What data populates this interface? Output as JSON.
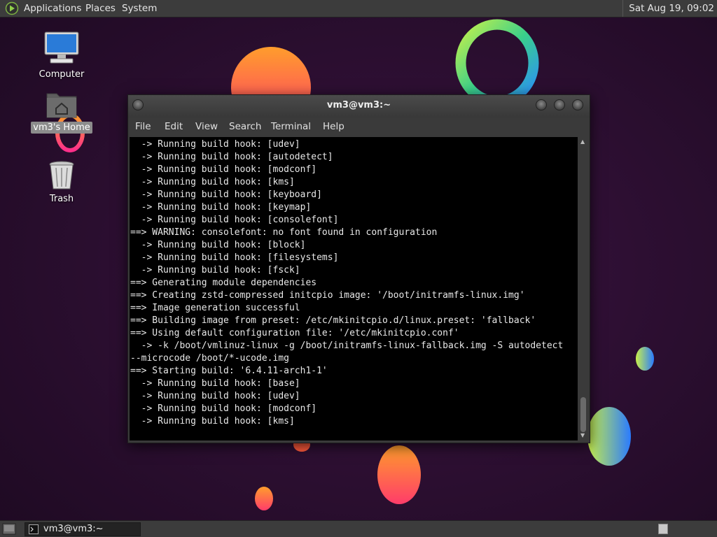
{
  "top_panel": {
    "menus": [
      "Applications",
      "Places",
      "System"
    ],
    "clock": "Sat Aug 19, 09:02"
  },
  "desktop_icons": [
    {
      "label": "Computer",
      "icon": "computer-icon"
    },
    {
      "label": "vm3's Home",
      "icon": "home-folder-icon",
      "selected": true
    },
    {
      "label": "Trash",
      "icon": "trash-icon"
    }
  ],
  "window": {
    "title": "vm3@vm3:~",
    "menu": [
      "File",
      "Edit",
      "View",
      "Search",
      "Terminal",
      "Help"
    ]
  },
  "terminal_lines": [
    "  -> Running build hook: [udev]",
    "  -> Running build hook: [autodetect]",
    "  -> Running build hook: [modconf]",
    "  -> Running build hook: [kms]",
    "  -> Running build hook: [keyboard]",
    "  -> Running build hook: [keymap]",
    "  -> Running build hook: [consolefont]",
    "==> WARNING: consolefont: no font found in configuration",
    "  -> Running build hook: [block]",
    "  -> Running build hook: [filesystems]",
    "  -> Running build hook: [fsck]",
    "==> Generating module dependencies",
    "==> Creating zstd-compressed initcpio image: '/boot/initramfs-linux.img'",
    "==> Image generation successful",
    "==> Building image from preset: /etc/mkinitcpio.d/linux.preset: 'fallback'",
    "==> Using default configuration file: '/etc/mkinitcpio.conf'",
    "  -> -k /boot/vmlinuz-linux -g /boot/initramfs-linux-fallback.img -S autodetect",
    "--microcode /boot/*-ucode.img",
    "==> Starting build: '6.4.11-arch1-1'",
    "  -> Running build hook: [base]",
    "  -> Running build hook: [udev]",
    "  -> Running build hook: [modconf]",
    "  -> Running build hook: [kms]"
  ],
  "taskbar": {
    "items": [
      {
        "label": "vm3@vm3:~",
        "icon": "terminal-icon"
      }
    ]
  },
  "colors": {
    "panel": "#3c3c3c",
    "desktop": "#2a0f2e",
    "terminal_bg": "#000000",
    "terminal_fg": "#e8e8e8"
  }
}
